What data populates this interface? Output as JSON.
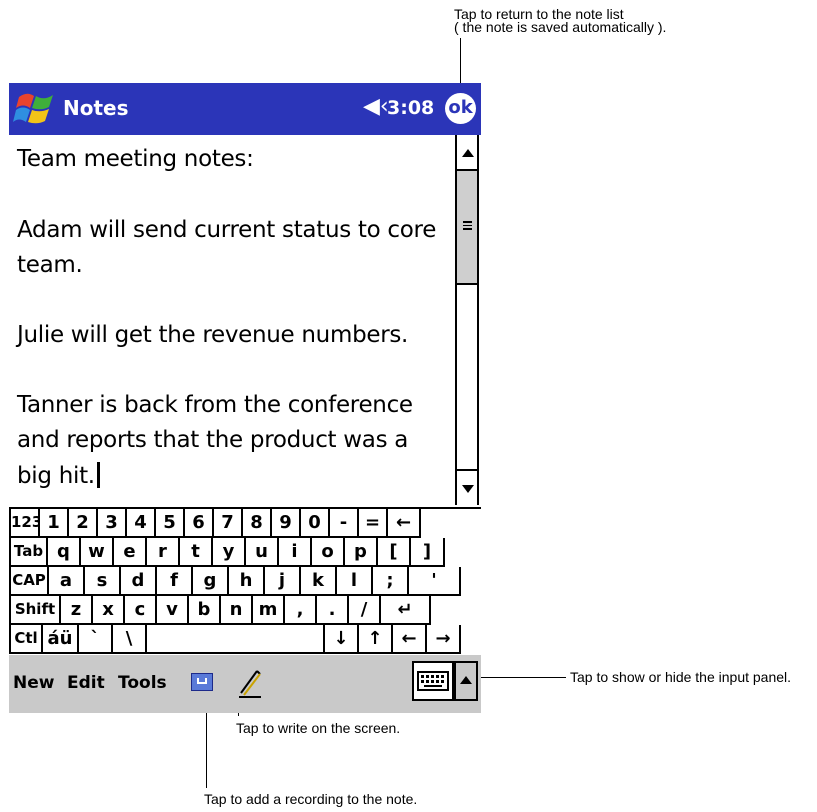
{
  "callouts": {
    "ok_line1": "Tap to return to the note list",
    "ok_line2": "( the note is saved automatically ).",
    "input_panel": "Tap to show or hide the input panel.",
    "write": "Tap to write on the screen.",
    "record": "Tap to add a recording to the note."
  },
  "titlebar": {
    "app_title": "Notes",
    "speaker_glyph": "◀‹",
    "time": "3:08",
    "ok_label": "ok",
    "bg_color": "#2b35b8"
  },
  "note": {
    "lines": [
      "Team meeting  notes:",
      "",
      "Adam will send current  status to core",
      "team.",
      "",
      "Julie will get the revenue numbers.",
      "",
      "Tanner is back from the conference",
      "and reports that the product  was a",
      "big hit."
    ]
  },
  "keyboard": {
    "rows": [
      [
        "123",
        "1",
        "2",
        "3",
        "4",
        "5",
        "6",
        "7",
        "8",
        "9",
        "0",
        "-",
        "=",
        "←"
      ],
      [
        "Tab",
        "q",
        "w",
        "e",
        "r",
        "t",
        "y",
        "u",
        "i",
        "o",
        "p",
        "[",
        "]"
      ],
      [
        "CAP",
        "a",
        "s",
        "d",
        "f",
        "g",
        "h",
        "j",
        "k",
        "l",
        ";",
        "'"
      ],
      [
        "Shift",
        "z",
        "x",
        "c",
        "v",
        "b",
        "n",
        "m",
        ",",
        ".",
        "/",
        "↵"
      ],
      [
        "Ctl",
        "áü",
        "`",
        "\\",
        "",
        "↓",
        "↑",
        "←",
        "→"
      ]
    ]
  },
  "menu": {
    "new": "New",
    "edit": "Edit",
    "tools": "Tools"
  }
}
